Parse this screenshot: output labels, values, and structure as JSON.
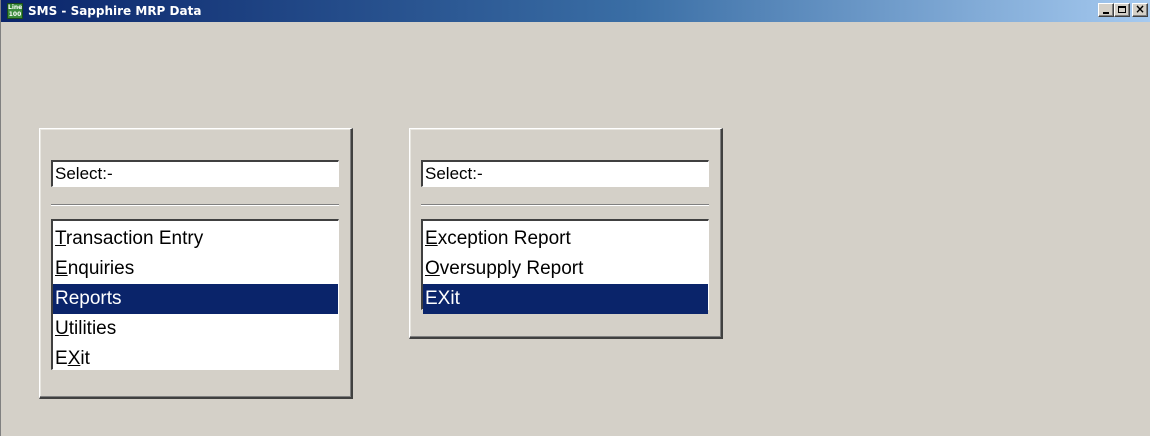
{
  "window": {
    "title": "SMS - Sapphire MRP Data",
    "icon_text": [
      "Line",
      "100"
    ],
    "icon_name": "line-100-app-icon",
    "controls": {
      "minimize": "minimize-icon",
      "maximize": "maximize-icon",
      "close": "close-icon"
    }
  },
  "colors": {
    "face": "#d4d0c8",
    "titlebar_start": "#0a246a",
    "titlebar_end": "#a6caf0",
    "selection": "#0a246a"
  },
  "menus": [
    {
      "select_label": "Select:-",
      "items": [
        {
          "key": "T",
          "rest": "ransaction Entry",
          "label": "Transaction Entry",
          "selected": false
        },
        {
          "key": "E",
          "rest": "nquiries",
          "label": "Enquiries",
          "selected": false
        },
        {
          "key": "",
          "rest": "Reports",
          "label": "Reports",
          "selected": true
        },
        {
          "key": "U",
          "rest": "tilities",
          "label": "Utilities",
          "selected": false
        },
        {
          "pre": "E",
          "key": "X",
          "rest": "it",
          "label": "EXit",
          "selected": false
        }
      ]
    },
    {
      "select_label": "Select:-",
      "items": [
        {
          "key": "E",
          "rest": "xception Report",
          "label": "Exception Report",
          "selected": false
        },
        {
          "key": "O",
          "rest": "versupply Report",
          "label": "Oversupply Report",
          "selected": false
        },
        {
          "key": "",
          "rest": "EXit",
          "label": "EXit",
          "selected": true
        }
      ]
    }
  ]
}
